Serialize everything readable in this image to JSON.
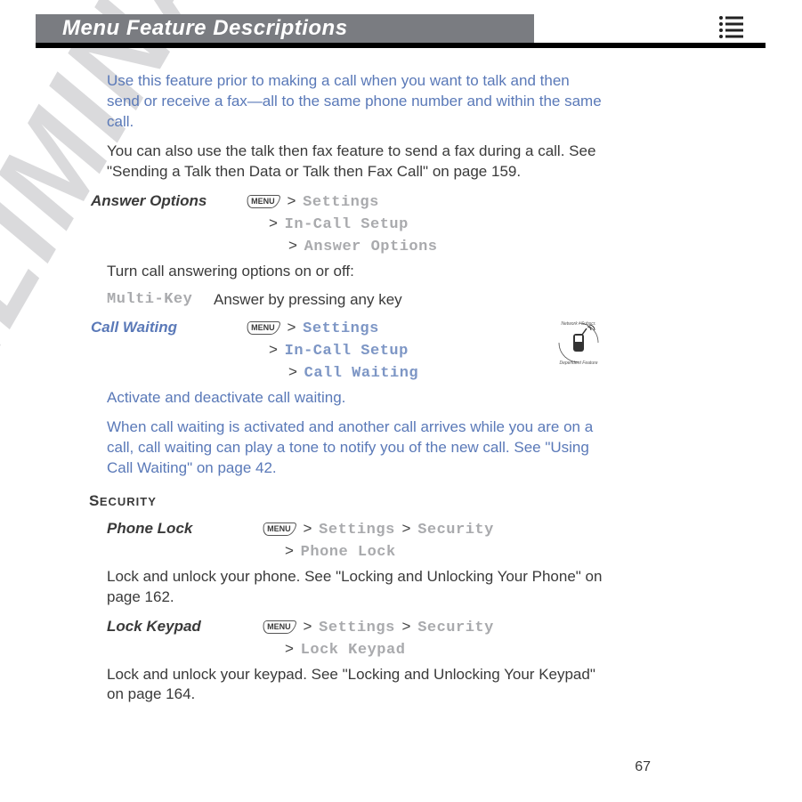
{
  "header": {
    "title": "Menu Feature Descriptions"
  },
  "watermark": "PRELIMINARY",
  "intro_blue": "Use this feature prior to making a call when you want to talk and then send or receive a fax—all to the same phone number and within the same call.",
  "intro2": "You can also use the talk then fax feature to send a fax during a call. See \"Sending a Talk then Data or Talk then Fax Call\" on page 159.",
  "menu_key": "MENU",
  "answer_options": {
    "label": "Answer Options",
    "path1": "Settings",
    "path2": "In-Call Setup",
    "path3": "Answer Options",
    "desc": "Turn call answering options on or off:",
    "opt_key": "Multi-Key",
    "opt_desc": "Answer by pressing any key"
  },
  "call_waiting": {
    "label": "Call Waiting",
    "path1": "Settings",
    "path2": "In-Call Setup",
    "path3": "Call Waiting",
    "badge_top": "Network / Subscription",
    "badge_bottom": "Dependent Feature",
    "desc1": "Activate and deactivate call waiting.",
    "desc2": "When call waiting is activated and another call arrives while you are on a call, call waiting can play a tone to notify you of the new call. See \"Using Call Waiting\" on page 42."
  },
  "security": {
    "heading": "SECURITY",
    "phone_lock": {
      "label": "Phone Lock",
      "p1a": "Settings",
      "p1b": "Security",
      "p2": "Phone Lock",
      "desc": "Lock and unlock your phone. See \"Locking and Unlocking Your Phone\" on page 162."
    },
    "lock_keypad": {
      "label": "Lock Keypad",
      "p1a": "Settings",
      "p1b": "Security",
      "p2": "Lock Keypad",
      "desc": "Lock and unlock your keypad. See \"Locking and Unlocking Your Keypad\" on page 164."
    }
  },
  "page_number": "67"
}
